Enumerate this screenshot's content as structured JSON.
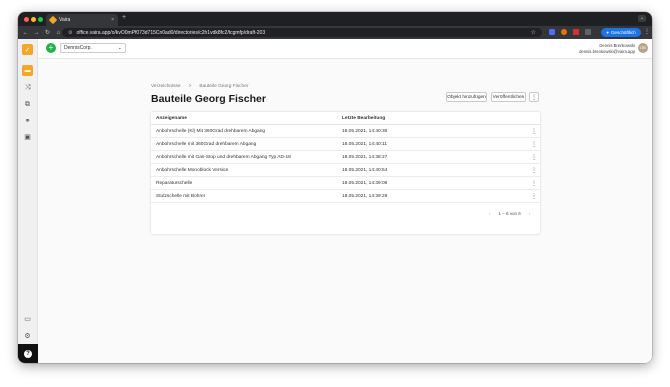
{
  "browser": {
    "tab_title": "Vaira",
    "tab_close": "×",
    "new_tab": "+",
    "tab_menu": "⌄",
    "url": "office.vaira.app/o/kvO0mPf073d715Cn0ad0/directories/c2h1vdk8fc2/tcgmfp/draft-203",
    "profile_label": "Geschäftlich",
    "colors": {
      "profile": "#1a73e8",
      "chrome_dark": "#35363a"
    }
  },
  "app": {
    "org_selector": "DennisCorp.",
    "user_name": "Dennis Brenkowski",
    "user_email": "dennis.brenkowski@vaira.app",
    "avatar_initials": "DB",
    "accent": "#f5a623"
  },
  "breadcrumb": {
    "items": [
      "Verzeichnisse",
      "Bauteile Georg Fischer"
    ],
    "separator": ">"
  },
  "page": {
    "title": "Bauteile Georg Fischer",
    "add_object_label": "Objekt hinzufügen",
    "publish_label": "Veröffentlichen",
    "more_label": "⋮"
  },
  "table": {
    "columns": [
      "Anzeigename",
      "Letzte Bearbeitung"
    ],
    "rows": [
      {
        "name": "Anbohrschelle (Kl) Mit 360Grad drehbarem Abgang",
        "date": "18.05.2021, 14:40:36"
      },
      {
        "name": "Anbohrschelle mit 360Grad drehbarem Abgang",
        "date": "18.05.2021, 14:40:11"
      },
      {
        "name": "Anbohrschelle mit Gas-Stop und drehbarem Abgang Typ AD-18",
        "date": "18.05.2021, 14:38:27"
      },
      {
        "name": "Anbohrschelle Monoblock Version",
        "date": "18.05.2021, 14:40:54"
      },
      {
        "name": "Reparaturschelle",
        "date": "18.05.2021, 14:39:06"
      },
      {
        "name": "Stutzschelle mit Bohrer",
        "date": "18.05.2021, 14:39:29"
      }
    ],
    "row_menu": "⋮"
  },
  "pagination": {
    "range": "1 – 6 von 6",
    "prev": "‹",
    "next": "›"
  }
}
